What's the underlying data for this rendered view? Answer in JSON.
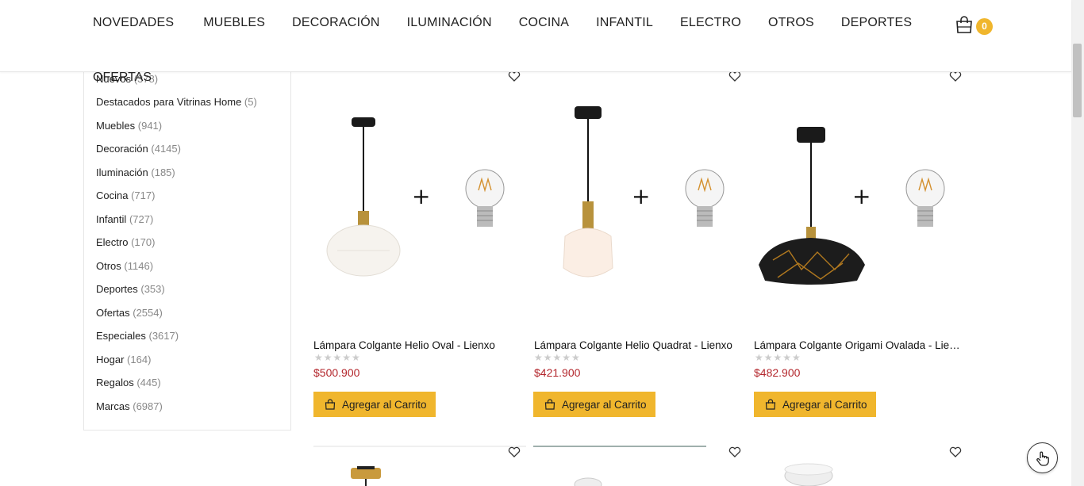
{
  "nav": {
    "items": [
      "NOVEDADES",
      "MUEBLES",
      "DECORACIÓN",
      "ILUMINACIÓN",
      "COCINA",
      "INFANTIL",
      "ELECTRO",
      "OTROS",
      "DEPORTES"
    ],
    "second_row": "OFERTAS",
    "cart_count": "0"
  },
  "sidebar": {
    "items": [
      {
        "label": "Nuevos",
        "count": "(378)"
      },
      {
        "label": "Destacados para Vitrinas Home",
        "count": "(5)"
      },
      {
        "label": "Muebles",
        "count": "(941)"
      },
      {
        "label": "Decoración",
        "count": "(4145)"
      },
      {
        "label": "Iluminación",
        "count": "(185)"
      },
      {
        "label": "Cocina",
        "count": "(717)"
      },
      {
        "label": "Infantil",
        "count": "(727)"
      },
      {
        "label": "Electro",
        "count": "(170)"
      },
      {
        "label": "Otros",
        "count": "(1146)"
      },
      {
        "label": "Deportes",
        "count": "(353)"
      },
      {
        "label": "Ofertas",
        "count": "(2554)"
      },
      {
        "label": "Especiales",
        "count": "(3617)"
      },
      {
        "label": "Hogar",
        "count": "(164)"
      },
      {
        "label": "Regalos",
        "count": "(445)"
      },
      {
        "label": "Marcas",
        "count": "(6987)"
      }
    ]
  },
  "products": [
    {
      "name": "Lámpara Colgante Helio Oval - Lienxo",
      "price": "$500.900",
      "rating": "0 of 5 stars",
      "button": "Agregar al Carrito"
    },
    {
      "name": "Lámpara Colgante Helio Quadrat - Lienxo",
      "price": "$421.900",
      "rating": "0 of 5 stars",
      "button": "Agregar al Carrito"
    },
    {
      "name": "Lámpara Colgante Origami Ovalada - Lienxo",
      "price": "$482.900",
      "rating": "0 of 5 stars",
      "button": "Agregar al Carrito"
    }
  ],
  "colors": {
    "accent": "#f0b62d",
    "price": "#b3262c"
  },
  "icons": [
    "shopping-bag-icon",
    "heart-icon",
    "bag-icon",
    "hand-pointer-icon"
  ]
}
